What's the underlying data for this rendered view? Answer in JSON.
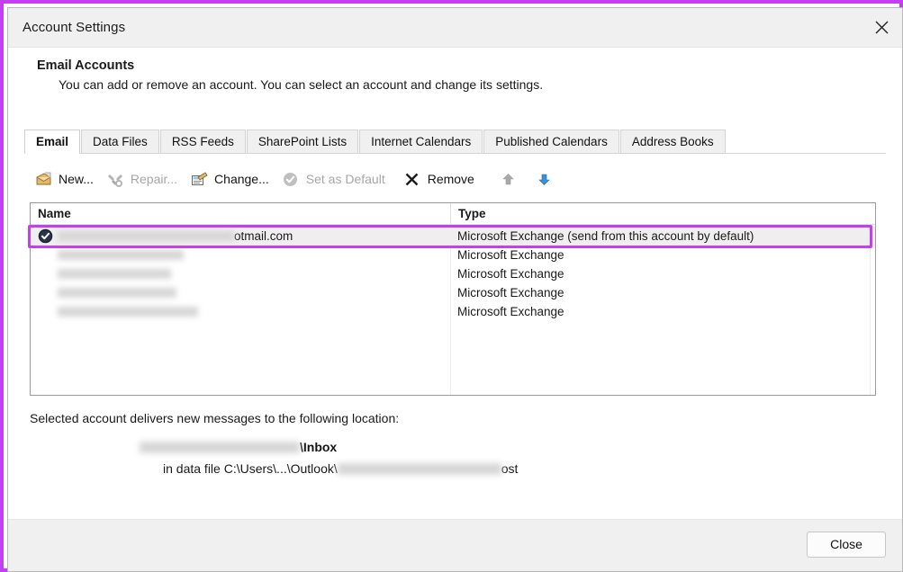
{
  "window": {
    "title": "Account Settings",
    "close_icon": "close-icon"
  },
  "header": {
    "title": "Email Accounts",
    "subtitle": "You can add or remove an account. You can select an account and change its settings."
  },
  "tabs": [
    {
      "label": "Email",
      "active": true
    },
    {
      "label": "Data Files",
      "active": false
    },
    {
      "label": "RSS Feeds",
      "active": false
    },
    {
      "label": "SharePoint Lists",
      "active": false
    },
    {
      "label": "Internet Calendars",
      "active": false
    },
    {
      "label": "Published Calendars",
      "active": false
    },
    {
      "label": "Address Books",
      "active": false
    }
  ],
  "toolbar": {
    "new_label": "New...",
    "repair_label": "Repair...",
    "change_label": "Change...",
    "set_default_label": "Set as Default",
    "remove_label": "Remove",
    "move_up_icon": "arrow-up-icon",
    "move_down_icon": "arrow-down-icon"
  },
  "list": {
    "columns": [
      "Name",
      "Type"
    ],
    "rows": [
      {
        "name_suffix": "otmail.com",
        "name_redacted": true,
        "type": "Microsoft Exchange (send from this account by default)",
        "is_default": true,
        "selected": true
      },
      {
        "name_suffix": "",
        "name_redacted": true,
        "type": "Microsoft Exchange",
        "is_default": false,
        "selected": false
      },
      {
        "name_suffix": "",
        "name_redacted": true,
        "type": "Microsoft Exchange",
        "is_default": false,
        "selected": false
      },
      {
        "name_suffix": "",
        "name_redacted": true,
        "type": "Microsoft Exchange",
        "is_default": false,
        "selected": false
      },
      {
        "name_suffix": "",
        "name_redacted": true,
        "type": "Microsoft Exchange",
        "is_default": false,
        "selected": false
      }
    ]
  },
  "delivery": {
    "label": "Selected account delivers new messages to the following location:",
    "line1_suffix": "\\Inbox",
    "line2_prefix": "in data file C:\\Users\\...\\Outlook\\",
    "line2_suffix": "ost"
  },
  "footer": {
    "close_label": "Close"
  },
  "colors": {
    "highlight": "#c33ff0",
    "dialog_bg": "#ffffff",
    "chrome_bg": "#f0f0f0",
    "selection_row": "#efefef"
  }
}
